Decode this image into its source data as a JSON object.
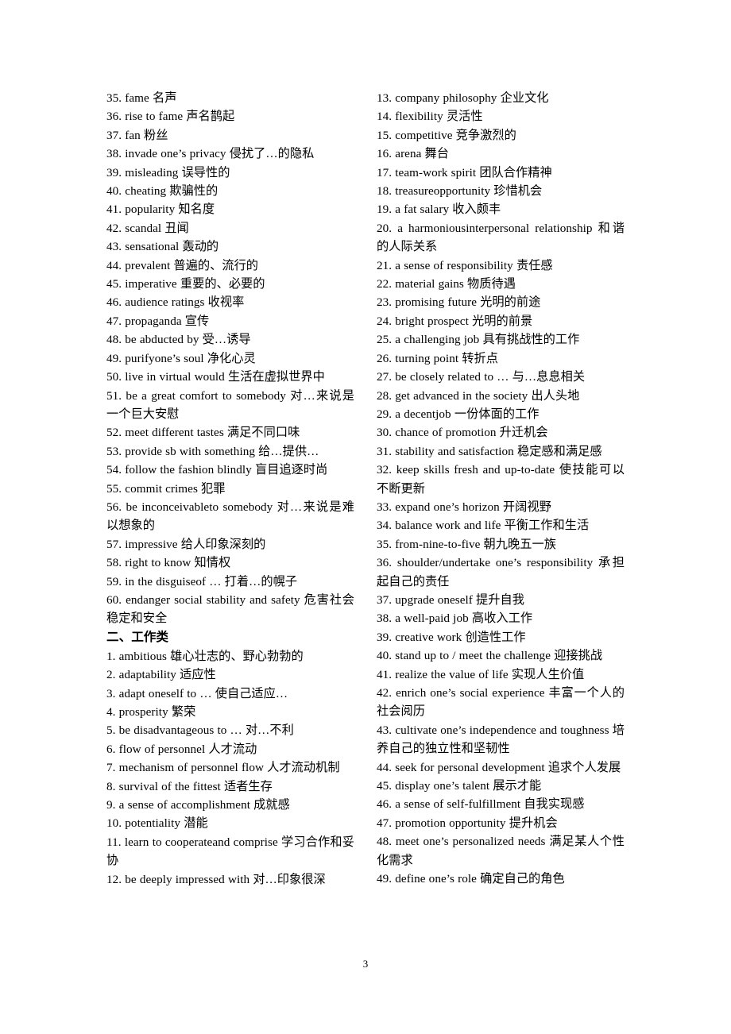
{
  "page": {
    "number": "3"
  },
  "left_column": {
    "entries": [
      {
        "id": "e35",
        "text": "35. fame  名声",
        "justify": false
      },
      {
        "id": "e36",
        "text": "36. rise to fame  声名鹊起",
        "justify": false
      },
      {
        "id": "e37",
        "text": "37. fan  粉丝",
        "justify": false
      },
      {
        "id": "e38",
        "text": "38. invade one’s privacy  侵扰了…的隐私",
        "justify": false
      },
      {
        "id": "e39",
        "text": "39. misleading 误导性的",
        "justify": false
      },
      {
        "id": "e40",
        "text": "40. cheating  欺骗性的",
        "justify": false
      },
      {
        "id": "e41",
        "text": "41. popularity  知名度",
        "justify": false
      },
      {
        "id": "e42",
        "text": "42. scandal  丑闻",
        "justify": false
      },
      {
        "id": "e43",
        "text": "43. sensational 轰动的",
        "justify": false
      },
      {
        "id": "e44",
        "text": "44. prevalent  普遍的、流行的",
        "justify": false
      },
      {
        "id": "e45",
        "text": "45. imperative 重要的、必要的",
        "justify": false
      },
      {
        "id": "e46",
        "text": "46. audience ratings  收视率",
        "justify": false
      },
      {
        "id": "e47",
        "text": "47. propaganda 宣传",
        "justify": false
      },
      {
        "id": "e48",
        "text": "48. be abducted by  受…诱导",
        "justify": false
      },
      {
        "id": "e49",
        "text": "49. purifyone’s soul  净化心灵",
        "justify": false
      },
      {
        "id": "e50",
        "text": "50. live in virtual would  生活在虚拟世界中",
        "justify": false
      },
      {
        "id": "e51",
        "text": "51. be a great comfort to somebody  对…来说是一个巨大安慰",
        "justify": true
      },
      {
        "id": "e52",
        "text": "52. meet different tastes  满足不同口味",
        "justify": false
      },
      {
        "id": "e53",
        "text": "53. provide sb with something  给…提供…",
        "justify": false
      },
      {
        "id": "e54",
        "text": "54. follow the fashion blindly 盲目追逐时尚",
        "justify": false
      },
      {
        "id": "e55",
        "text": "55. commit crimes  犯罪",
        "justify": false
      },
      {
        "id": "e56",
        "text": "56. be inconceivableto somebody  对…来说是难以想象的",
        "justify": true
      },
      {
        "id": "e57",
        "text": "57. impressive  给人印象深刻的",
        "justify": false
      },
      {
        "id": "e58",
        "text": "58. right to know  知情权",
        "justify": false
      },
      {
        "id": "e59",
        "text": "59. in the disguiseof …  打着…的幌子",
        "justify": false
      },
      {
        "id": "e60",
        "text": "60. endanger social stability and safety  危害社会稳定和安全",
        "justify": true
      }
    ],
    "heading": "二、工作类",
    "entries_after_heading": [
      {
        "id": "w1",
        "text": "1. ambitious  雄心壮志的、野心勃勃的",
        "justify": false
      },
      {
        "id": "w2",
        "text": "2. adaptability 适应性",
        "justify": false
      },
      {
        "id": "w3",
        "text": "3. adapt oneself to  …  使自己适应…",
        "justify": false
      },
      {
        "id": "w4",
        "text": "4. prosperity 繁荣",
        "justify": false
      },
      {
        "id": "w5",
        "text": "5. be disadvantageous to  …  对…不利",
        "justify": false
      },
      {
        "id": "w6",
        "text": "6. flow of personnel  人才流动",
        "justify": false
      },
      {
        "id": "w7",
        "text": "7. mechanism of personnel flow 人才流动机制",
        "justify": true
      },
      {
        "id": "w8",
        "text": "8. survival of the fittest  适者生存",
        "justify": false
      },
      {
        "id": "w9",
        "text": "9. a sense of accomplishment 成就感",
        "justify": false
      },
      {
        "id": "w10",
        "text": "10. potentiality 潜能",
        "justify": false
      },
      {
        "id": "w11",
        "text": "11. learn to cooperateand comprise  学习合作和妥协",
        "justify": true
      },
      {
        "id": "w12",
        "text": "12. be deeply impressed with  对…印象很深",
        "justify": false
      }
    ]
  },
  "right_column": {
    "entries": [
      {
        "id": "w13",
        "text": "13. company philosophy 企业文化",
        "justify": false
      },
      {
        "id": "w14",
        "text": "14. flexibility  灵活性",
        "justify": false
      },
      {
        "id": "w15",
        "text": "15. competitive  竞争激烈的",
        "justify": false
      },
      {
        "id": "w16",
        "text": "16. arena  舞台",
        "justify": false
      },
      {
        "id": "w17",
        "text": "17. team-work spirit  团队合作精神",
        "justify": false
      },
      {
        "id": "w18",
        "text": "18. treasureopportunity  珍惜机会",
        "justify": false
      },
      {
        "id": "w19",
        "text": "19. a fat salary  收入颇丰",
        "justify": false
      },
      {
        "id": "w20",
        "text": "20. a harmoniousinterpersonal relationship  和谐的人际关系",
        "justify": true
      },
      {
        "id": "w21",
        "text": "21. a sense of responsibility  责任感",
        "justify": false
      },
      {
        "id": "w22",
        "text": "22. material gains  物质待遇",
        "justify": false
      },
      {
        "id": "w23",
        "text": "23. promising future  光明的前途",
        "justify": false
      },
      {
        "id": "w24",
        "text": "24. bright prospect  光明的前景",
        "justify": false
      },
      {
        "id": "w25",
        "text": "25. a challenging job 具有挑战性的工作",
        "justify": false
      },
      {
        "id": "w26",
        "text": "26. turning point  转折点",
        "justify": false
      },
      {
        "id": "w27",
        "text": "27. be closely related to  …  与…息息相关",
        "justify": false
      },
      {
        "id": "w28",
        "text": "28. get advanced in the society  出人头地",
        "justify": false
      },
      {
        "id": "w29",
        "text": "29. a decentjob  一份体面的工作",
        "justify": false
      },
      {
        "id": "w30",
        "text": "30. chance of promotion 升迁机会",
        "justify": false
      },
      {
        "id": "w31",
        "text": "31. stability and satisfaction  稳定感和满足感",
        "justify": false
      },
      {
        "id": "w32",
        "text": "32. keep skills fresh and up-to-date  使技能可以不断更新",
        "justify": true
      },
      {
        "id": "w33",
        "text": "33. expand one’s horizon 开阔视野",
        "justify": false
      },
      {
        "id": "w34",
        "text": "34. balance work and life  平衡工作和生活",
        "justify": false
      },
      {
        "id": "w35",
        "text": "35. from-nine-to-five  朝九晚五一族",
        "justify": false
      },
      {
        "id": "w36",
        "text": "36. shoulder/undertake one’s responsibility 承担起自己的责任",
        "justify": true
      },
      {
        "id": "w37",
        "text": "37. upgrade oneself  提升自我",
        "justify": false
      },
      {
        "id": "w38",
        "text": "38. a well-paid job  高收入工作",
        "justify": false
      },
      {
        "id": "w39",
        "text": "39. creative work  创造性工作",
        "justify": false
      },
      {
        "id": "w40",
        "text": "40. stand up to / meet the challenge  迎接挑战",
        "justify": false
      },
      {
        "id": "w41",
        "text": "41. realize the value of life  实现人生价值",
        "justify": false
      },
      {
        "id": "w42",
        "text": "42. enrich one’s social experience  丰富一个人的社会阅历",
        "justify": true
      },
      {
        "id": "w43",
        "text": "43.  cultivate  one’s  independence  and toughness 培养自己的独立性和坚韧性",
        "justify": true
      },
      {
        "id": "w44",
        "text": "44. seek for personal development  追求个人发展",
        "justify": true
      },
      {
        "id": "w45",
        "text": "45. display one’s talent  展示才能",
        "justify": false
      },
      {
        "id": "w46",
        "text": "46. a sense of self-fulfillment  自我实现感",
        "justify": false
      },
      {
        "id": "w47",
        "text": "47. promotion opportunity  提升机会",
        "justify": false
      },
      {
        "id": "w48",
        "text": "48. meet one’s personalized needs  满足某人个性化需求",
        "justify": true
      },
      {
        "id": "w49",
        "text": "49. define one’s role  确定自己的角色",
        "justify": false
      }
    ]
  }
}
